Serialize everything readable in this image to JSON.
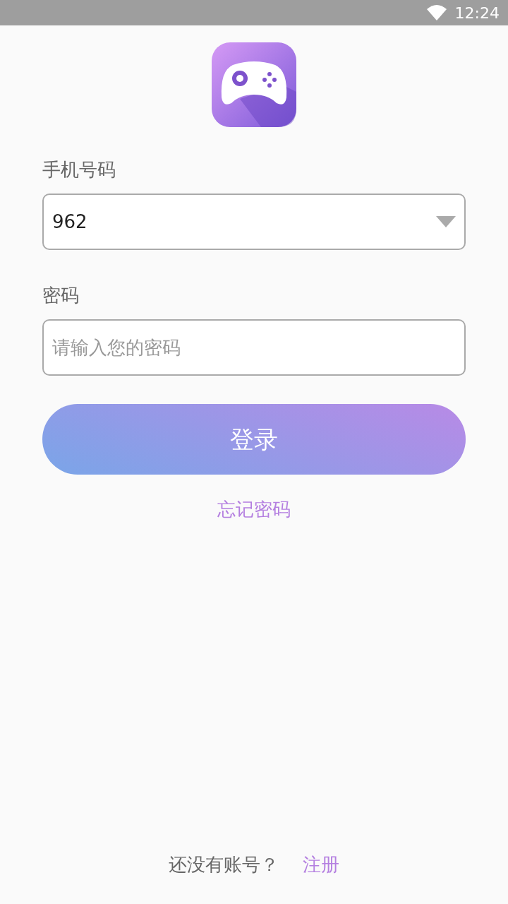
{
  "status_bar": {
    "time": "12:24"
  },
  "phone": {
    "label": "手机号码",
    "value": "962"
  },
  "password": {
    "label": "密码",
    "placeholder": "请输入您的密码"
  },
  "login_button": "登录",
  "forgot_link": "忘记密码",
  "footer": {
    "text": "还没有账号？",
    "link": "注册"
  }
}
